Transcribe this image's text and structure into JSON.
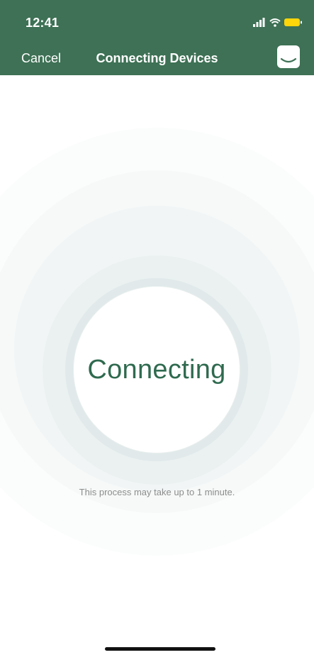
{
  "status_bar": {
    "time": "12:41"
  },
  "nav": {
    "cancel_label": "Cancel",
    "title": "Connecting Devices",
    "chat_icon": "chat-bubble-icon"
  },
  "main": {
    "status_text": "Connecting",
    "note": "This process may take up to 1 minute."
  },
  "colors": {
    "header_bg": "#3e7155",
    "accent": "#2f6a4f",
    "battery": "#ffd60a"
  }
}
